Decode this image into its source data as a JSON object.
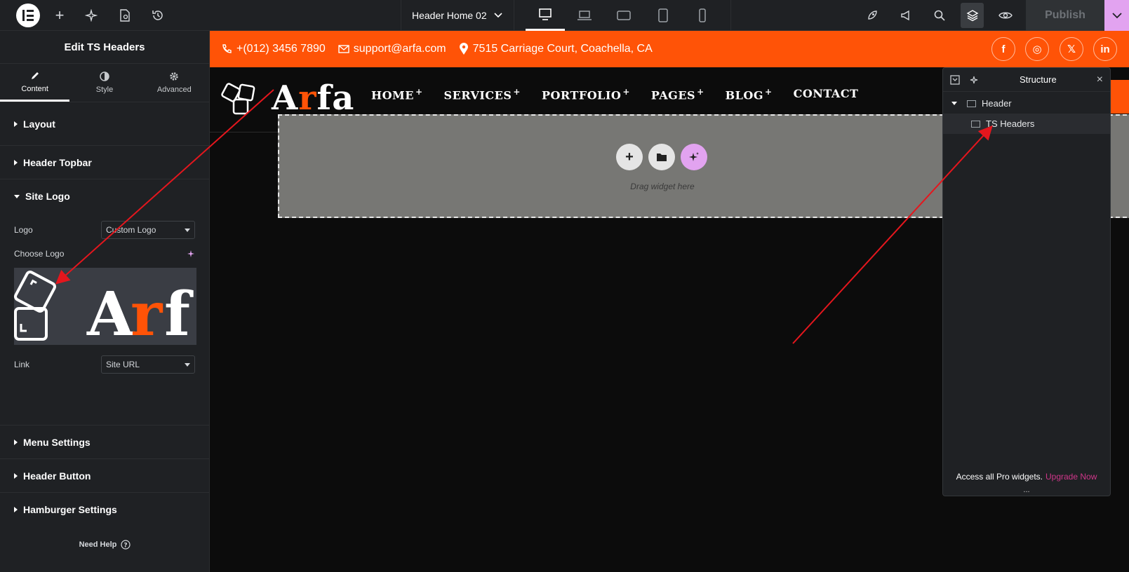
{
  "topbar": {
    "doc_title": "Header Home 02",
    "publish_label": "Publish"
  },
  "panel": {
    "title": "Edit TS Headers",
    "tabs": [
      {
        "label": "Content",
        "icon": "pencil-icon"
      },
      {
        "label": "Style",
        "icon": "contrast-icon"
      },
      {
        "label": "Advanced",
        "icon": "gear-icon"
      }
    ],
    "sections": {
      "layout": "Layout",
      "topbar": "Header Topbar",
      "site_logo": "Site Logo",
      "menu": "Menu Settings",
      "button": "Header Button",
      "hamburger": "Hamburger Settings"
    },
    "logo_label": "Logo",
    "logo_value": "Custom Logo",
    "choose_logo": "Choose Logo",
    "link_label": "Link",
    "link_value": "Site URL",
    "need_help": "Need Help"
  },
  "site": {
    "phone": "+(012) 3456 7890",
    "email": "support@arfa.com",
    "address": "7515 Carriage Court, Coachella, CA",
    "brand_first": "A",
    "brand_accent": "r",
    "brand_rest": "fa",
    "nav": [
      {
        "label": "HOME",
        "plus": "+"
      },
      {
        "label": "SERVICES",
        "plus": "+"
      },
      {
        "label": "PORTFOLIO",
        "plus": "+"
      },
      {
        "label": "PAGES",
        "plus": "+"
      },
      {
        "label": "BLOG",
        "plus": "+"
      },
      {
        "label": "CONTACT",
        "plus": ""
      }
    ],
    "social": [
      {
        "glyph": "f",
        "icon": "facebook-icon"
      },
      {
        "glyph": "◎",
        "icon": "instagram-icon"
      },
      {
        "glyph": "𝕏",
        "icon": "x-icon"
      },
      {
        "glyph": "in",
        "icon": "linkedin-icon"
      }
    ],
    "drop_text": "Drag widget here"
  },
  "structure": {
    "title": "Structure",
    "items": [
      "Header",
      "TS Headers"
    ],
    "footer_text": "Access all Pro widgets.",
    "upgrade": "Upgrade Now",
    "dots": "..."
  },
  "colors": {
    "accent": "#ff5307",
    "ai": "#e2a3f0",
    "upgrade": "#d0368a"
  }
}
